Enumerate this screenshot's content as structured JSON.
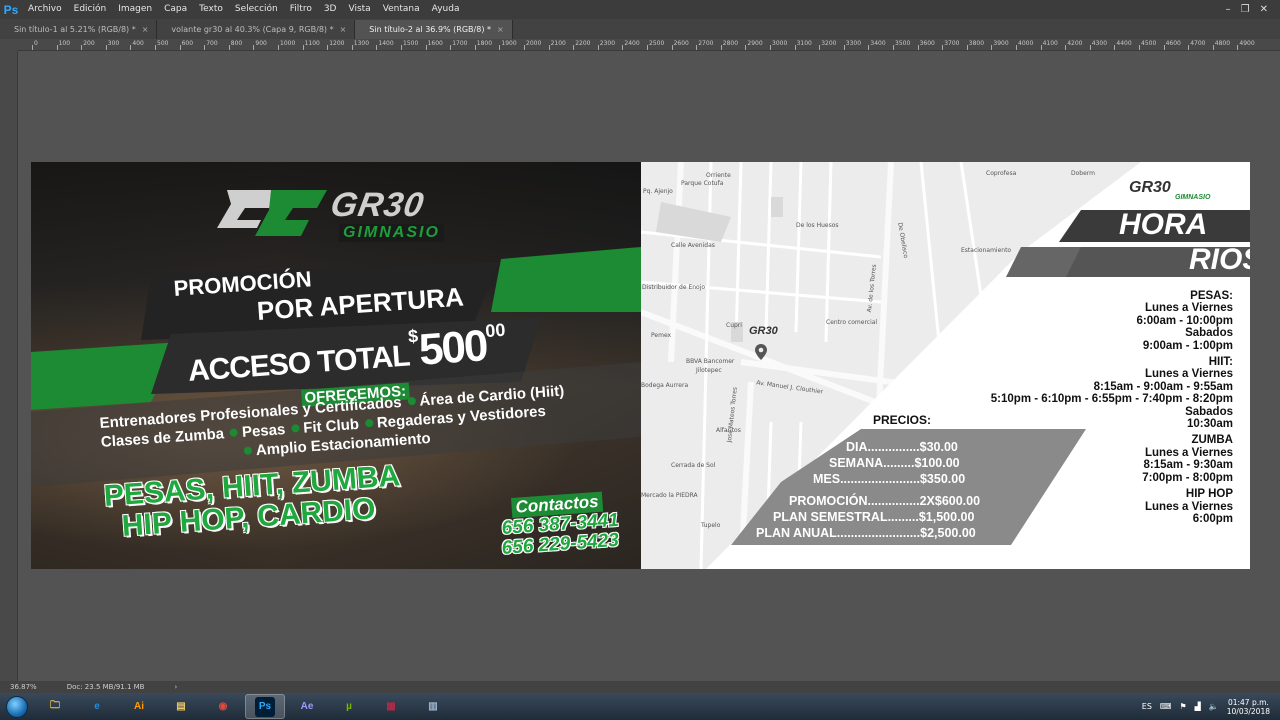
{
  "app": {
    "logo": "Ps",
    "menu": [
      "Archivo",
      "Edición",
      "Imagen",
      "Capa",
      "Texto",
      "Selección",
      "Filtro",
      "3D",
      "Vista",
      "Ventana",
      "Ayuda"
    ]
  },
  "tabs": [
    {
      "label": "Sin título-1 al 5.21% (RGB/8) *",
      "close": "×"
    },
    {
      "label": "volante gr30 al 40.3% (Capa 9, RGB/8) *",
      "close": "×"
    },
    {
      "label": "Sin título-2 al 36.9% (RGB/8) *",
      "close": "×"
    }
  ],
  "ruler": {
    "h_ticks": [
      "0",
      "100",
      "200",
      "300",
      "400",
      "500",
      "600",
      "700",
      "800",
      "900",
      "1000",
      "1100",
      "1200",
      "1300",
      "1400",
      "1500",
      "1600",
      "1700",
      "1800",
      "1900",
      "2000",
      "2100",
      "2200",
      "2300",
      "2400",
      "2500",
      "2600",
      "2700",
      "2800",
      "2900",
      "3000",
      "3100",
      "3200",
      "3300",
      "3400",
      "3500",
      "3600",
      "3700",
      "3800",
      "3900",
      "4000",
      "4100",
      "4200",
      "4300",
      "4400",
      "4500",
      "4600",
      "4700",
      "4800",
      "4900"
    ]
  },
  "flyer": {
    "brand_main": "GR30",
    "brand_sub": "GIMNASIO",
    "promo_line1": "PROMOCIÓN",
    "promo_line2": "POR APERTURA",
    "acceso_label": "ACCESO TOTAL",
    "acceso_currency": "$",
    "acceso_amount": "500",
    "acceso_cents": "00",
    "ofrecemos": "OFRECEMOS:",
    "services_line1_a": "Entrenadores Profesionales y Certificados",
    "services_line1_b": "Área de Cardio (Hiit)",
    "services_line2_a": "Clases de Zumba",
    "services_line2_b": "Pesas",
    "services_line2_c": "Fit Club",
    "services_line2_d": "Regaderas y Vestidores",
    "services_line3": "Amplio Estacionamiento",
    "big_line1": "PESAS, HIIT, ZUMBA",
    "big_line2": "HIP HOP, CARDIO",
    "contact_label": "Contactos",
    "phone1": "656 387-3441",
    "phone2": "656 229-5423",
    "horarios_a": "HORA",
    "horarios_b": "RIOS",
    "schedule": [
      {
        "head": "PESAS:",
        "lines": [
          "Lunes a Viernes",
          "6:00am - 10:00pm",
          "Sabados",
          "9:00am - 1:00pm"
        ]
      },
      {
        "head": "HIIT:",
        "lines": [
          "Lunes a Viernes",
          "8:15am - 9:00am - 9:55am",
          "5:10pm - 6:10pm - 6:55pm - 7:40pm - 8:20pm",
          "Sabados",
          "10:30am"
        ]
      },
      {
        "head": "ZUMBA",
        "lines": [
          "Lunes a Viernes",
          "8:15am - 9:30am",
          "7:00pm - 8:00pm"
        ]
      },
      {
        "head": "HIP HOP",
        "lines": [
          "Lunes a Viernes",
          "6:00pm"
        ]
      }
    ],
    "prices_title": "PRECIOS:",
    "prices": [
      {
        "label": "DIA...............",
        "value": "$30.00"
      },
      {
        "label": "SEMANA.........",
        "value": "$100.00"
      },
      {
        "label": "MES.......................",
        "value": "$350.00"
      },
      {
        "label": "PROMOCIÓN...............",
        "value": "2X$600.00"
      },
      {
        "label": "PLAN SEMESTRAL.........",
        "value": "$1,500.00"
      },
      {
        "label": "PLAN ANUAL........................",
        "value": "$2,500.00"
      }
    ],
    "map_labels": [
      "Parque Cotufa",
      "Pq. Ajenjo",
      "Coprofesa",
      "Centro comercial",
      "Cupri",
      "Pemex",
      "BBVA Bancomer",
      "Jilotepec",
      "Bodega Aurrera",
      "Av. Manuel J. Clouthier",
      "Av. de los Torres",
      "De Obelisco",
      "Calle Avenidas",
      "Estacionamiento",
      "Distribuidor de Enojo",
      "José Mateos Torres",
      "Cerrada de Sol",
      "Alfaritos",
      "Orriente",
      "Tupelo",
      "De los Huesos",
      "Mercado la PIEDRA",
      "Doberm"
    ]
  },
  "status": {
    "zoom": "36.87%",
    "doc": "Doc: 23.5 MB/91.1 MB"
  },
  "taskbar": {
    "apps": [
      {
        "name": "folder",
        "glyph": "🗀",
        "color": "#f2c14e",
        "active": false
      },
      {
        "name": "ie",
        "glyph": "e",
        "color": "#1f8fe0",
        "active": false
      },
      {
        "name": "illustrator",
        "glyph": "Ai",
        "color": "#ff9a00",
        "active": false
      },
      {
        "name": "explorer",
        "glyph": "▤",
        "color": "#e8c66a",
        "active": false
      },
      {
        "name": "chrome",
        "glyph": "◉",
        "color": "#e14a3b",
        "active": false
      },
      {
        "name": "photoshop",
        "glyph": "Ps",
        "color": "#31a8ff",
        "active": true
      },
      {
        "name": "aftereffects",
        "glyph": "Ae",
        "color": "#9999ff",
        "active": false
      },
      {
        "name": "utorrent",
        "glyph": "µ",
        "color": "#76b900",
        "active": false
      },
      {
        "name": "winrar",
        "glyph": "▦",
        "color": "#b02a4a",
        "active": false
      },
      {
        "name": "calculator",
        "glyph": "▥",
        "color": "#9fb8d0",
        "active": false
      }
    ],
    "lang": "ES",
    "time": "01:47 p.m.",
    "date": "10/03/2018"
  },
  "colors": {
    "accent": "#1c8b33",
    "ps_blue": "#31a8ff"
  }
}
